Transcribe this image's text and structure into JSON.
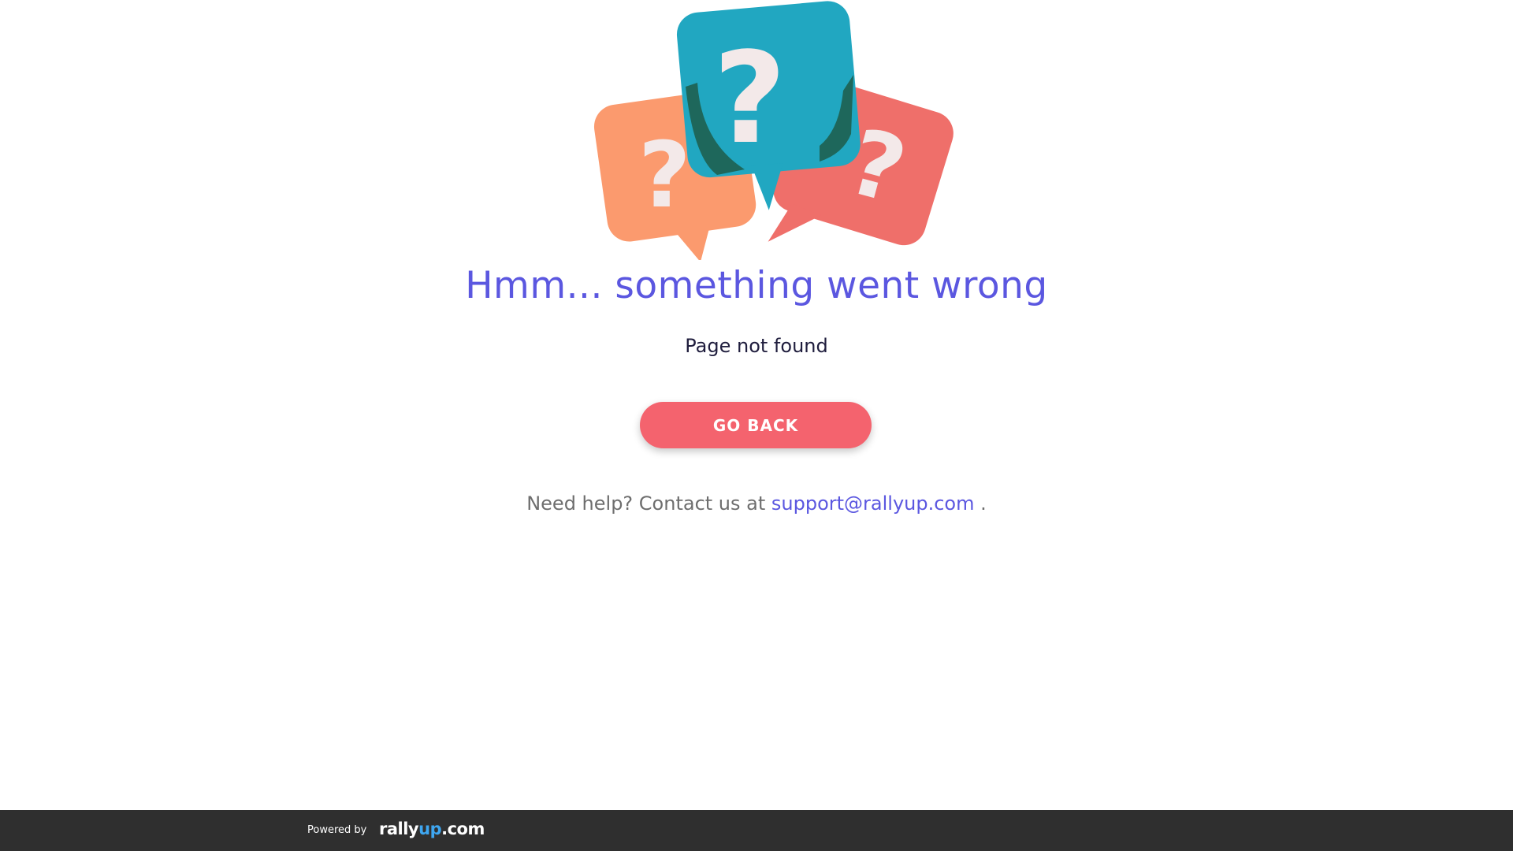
{
  "illustration": {
    "icon": "question-speech-bubbles",
    "colors": {
      "left_bubble": "#fb9a6e",
      "center_bubble": "#21a7c1",
      "right_bubble": "#ef6f6a",
      "overlap": "#1e6050",
      "mark": "#f3e9e9"
    }
  },
  "error": {
    "title": "Hmm... something went wrong",
    "subtitle": "Page not found"
  },
  "actions": {
    "go_back_label": "GO BACK"
  },
  "help": {
    "prefix": "Need help? Contact us at",
    "email": "support@rallyup.com",
    "suffix": "."
  },
  "footer": {
    "powered_by": "Powered by",
    "brand_rally": "rally",
    "brand_up": "up",
    "brand_com": ".com"
  },
  "colors": {
    "accent": "#5b57e0",
    "button": "#f4636e",
    "footer_bg": "#2f2f2f",
    "brand_up": "#3ea6f0"
  }
}
